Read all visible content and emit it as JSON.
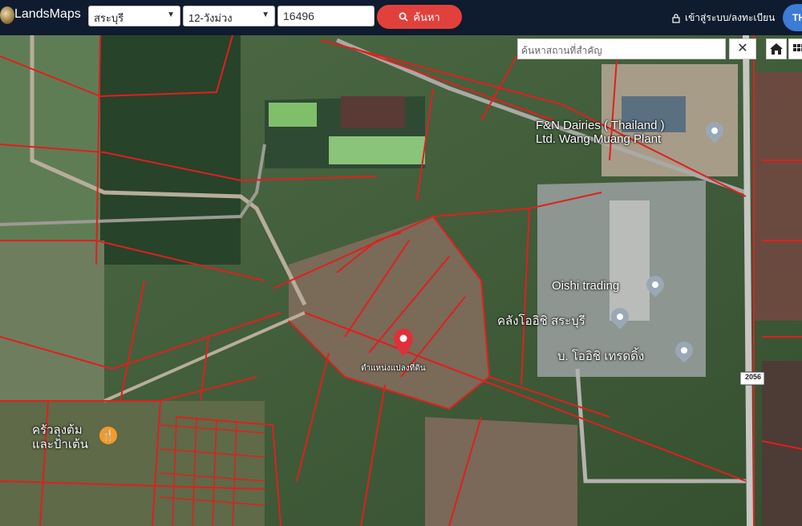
{
  "header": {
    "logo_text": "LandsMaps",
    "province": "สระบุรี",
    "district": "12-วังม่วง",
    "parcel_no": "16496",
    "search_label": "ค้นหา",
    "login_label": "เข้าสู่ระบบ/ลงทะเบียน",
    "lang_label": "TH"
  },
  "map": {
    "search_placeholder": "ค้นหาสถานที่สำคัญ",
    "close_label": "✕",
    "places": [
      {
        "name": "F&N Dairies ( Thailand )\nLtd. Wang Muang Plant"
      },
      {
        "name": "Oishi trading"
      },
      {
        "name": "คลังโออิชิ สระบุรี"
      },
      {
        "name": "บ. โออิชิ เทรดดิ้ง"
      },
      {
        "name": "ครัวลุงต้ม\nและป้าเต้น"
      }
    ],
    "marker_label": "ตำแหน่งแปลงที่ดิน",
    "road_badge": "2056"
  },
  "colors": {
    "topbar": "#0f1b2e",
    "search_button": "#e2413b",
    "lang_button": "#3c7bd6",
    "parcel_lines": "#e01f1f",
    "marker": "#e0303a"
  },
  "icons": {
    "search": "search-icon",
    "lock": "lock-icon",
    "home": "home-icon",
    "layers": "grid-icon",
    "close": "close-icon",
    "marker": "map-pin-icon"
  }
}
